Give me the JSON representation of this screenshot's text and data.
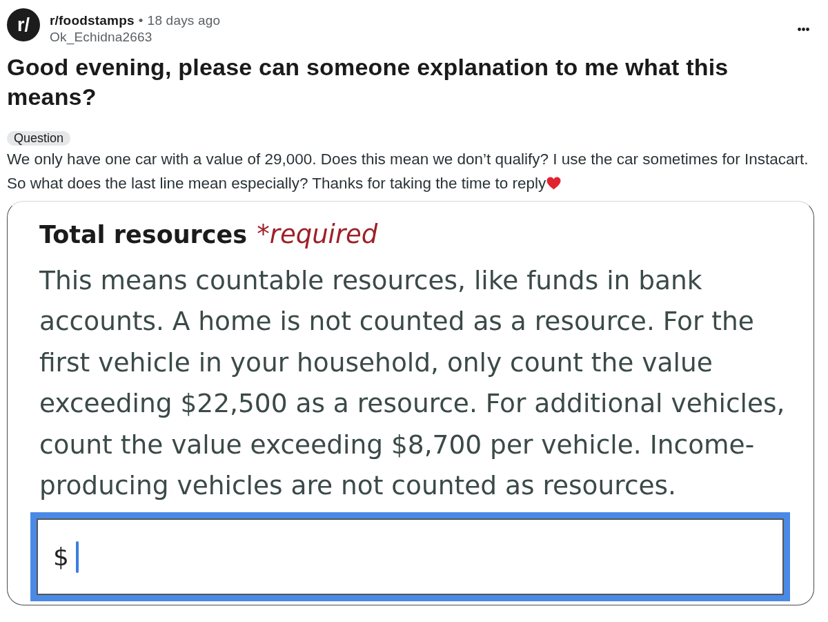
{
  "post": {
    "community": {
      "avatar_text": "r/",
      "name": "r/foodstamps",
      "separator": "•",
      "time": "18 days ago"
    },
    "author": "Ok_Echidna2663",
    "title": "Good evening, please can someone explanation to me what this means?",
    "flair": "Question",
    "body_lines": [
      "We only have one car with a value of 29,000. Does this mean we don’t qualify? I use the car sometimes for Instacart.",
      "So what does the last line mean especially? Thanks for taking the time to reply"
    ]
  },
  "screenshot": {
    "heading": "Total resources",
    "required_label": "*required",
    "description": "This means countable resources, like funds in bank accounts. A home is not counted as a resource. For the first vehicle in your household, only count the value exceeding $22,500 as a resource. For additional vehicles, count the value exceeding $8,700 per vehicle. Income-producing vehicles are not counted as resources.",
    "input": {
      "prefix": "$",
      "focused": true
    }
  }
}
